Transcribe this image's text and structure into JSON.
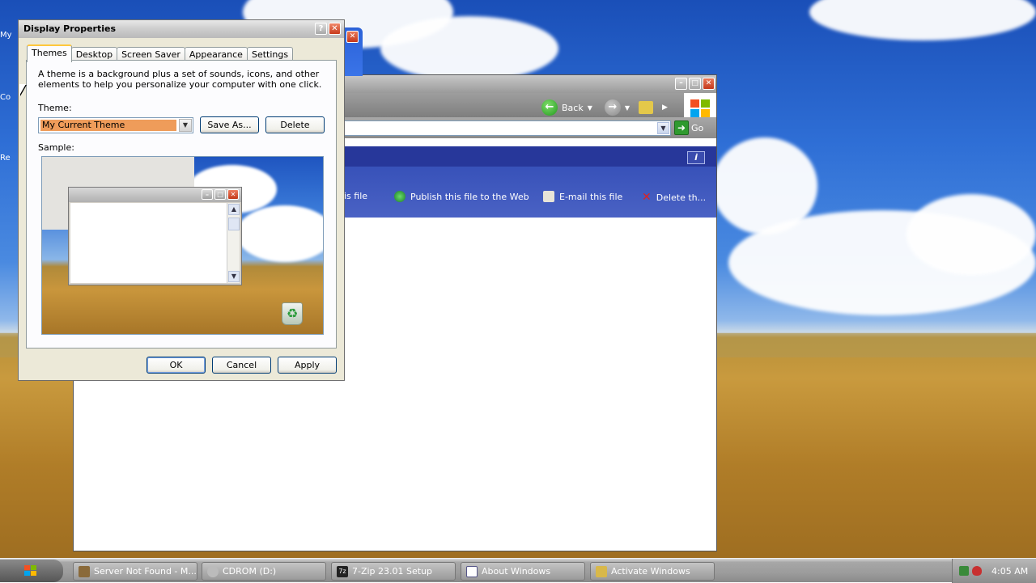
{
  "dialog": {
    "title": "Display Properties",
    "tabs": [
      {
        "label": "Themes",
        "active": true
      },
      {
        "label": "Desktop",
        "active": false
      },
      {
        "label": "Screen Saver",
        "active": false
      },
      {
        "label": "Appearance",
        "active": false
      },
      {
        "label": "Settings",
        "active": false
      }
    ],
    "description": "A theme is a background plus a set of sounds, icons, and other elements to help you personalize your computer with one click.",
    "theme_label": "Theme:",
    "theme_value": "My Current Theme",
    "save_as_label": "Save As...",
    "delete_label": "Delete",
    "sample_label": "Sample:",
    "ok_label": "OK",
    "cancel_label": "Cancel",
    "apply_label": "Apply",
    "help_glyph": "?",
    "close_glyph": "✕"
  },
  "explorer": {
    "back_label": "Back",
    "go_label": "Go",
    "tasks": [
      {
        "label": "is file"
      },
      {
        "label": "Publish this file to the Web"
      },
      {
        "label": "E-mail this file"
      },
      {
        "label": "Delete th..."
      }
    ]
  },
  "desktop": {
    "icon_fragments": [
      "My",
      "Co",
      "Re"
    ]
  },
  "taskbar": {
    "items": [
      {
        "label": "Server Not Found - M..."
      },
      {
        "label": "CDROM (D:)"
      },
      {
        "label": "7-Zip 23.01 Setup"
      },
      {
        "label": "About Windows"
      },
      {
        "label": "Activate Windows"
      }
    ],
    "clock": "4:05 AM"
  },
  "colors": {
    "theme_highlight": "#ef9c5a",
    "active_tab_accent": "#ffc73c",
    "banner_blue": "#3650b8"
  }
}
